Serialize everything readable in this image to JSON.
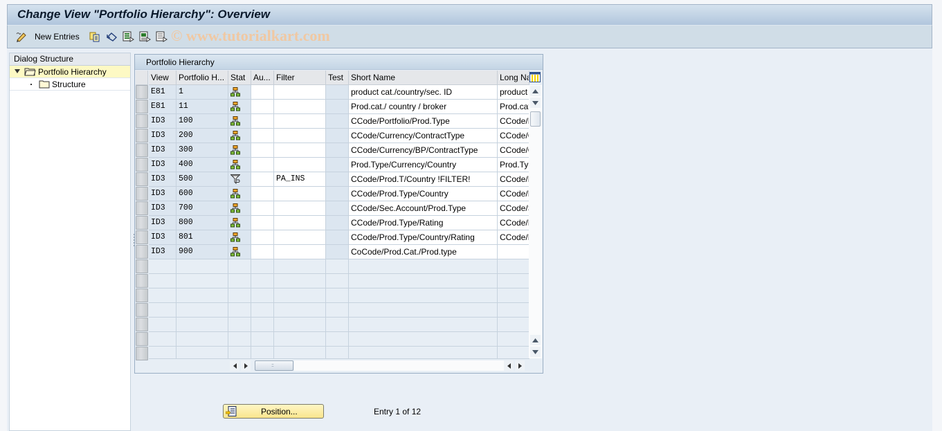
{
  "window": {
    "title": "Change View \"Portfolio Hierarchy\": Overview"
  },
  "toolbar": {
    "items": [
      {
        "icon": "edit-pencil-icon",
        "label": ""
      },
      {
        "icon": "new-entries-label",
        "label": "New Entries"
      },
      {
        "icon": "copy-as-icon",
        "label": ""
      },
      {
        "icon": "undo-change-icon",
        "label": ""
      },
      {
        "icon": "select-all-icon",
        "label": ""
      },
      {
        "icon": "select-block-icon",
        "label": ""
      },
      {
        "icon": "deselect-all-icon",
        "label": ""
      }
    ],
    "new_entries_label": "New Entries",
    "watermark": "© www.tutorialkart.com"
  },
  "dialog_structure": {
    "header": "Dialog Structure",
    "items": [
      {
        "label": "Portfolio Hierarchy",
        "expanded": true,
        "selected": true,
        "icon": "folder-open-icon"
      },
      {
        "label": "Structure",
        "expanded": false,
        "selected": false,
        "icon": "folder-icon"
      }
    ]
  },
  "table": {
    "title": "Portfolio Hierarchy",
    "columns": [
      "View",
      "Portfolio H...",
      "Stat",
      "Au...",
      "Filter",
      "Test",
      "Short Name",
      "Long Na"
    ],
    "rows": [
      {
        "view": "E81",
        "portfolio": "1",
        "stat": "hierarchy-icon",
        "au": "",
        "filter": "",
        "test": "",
        "short_name": "product cat./country/sec. ID",
        "long_name": "product"
      },
      {
        "view": "E81",
        "portfolio": "11",
        "stat": "hierarchy-icon",
        "au": "",
        "filter": "",
        "test": "",
        "short_name": "Prod.cat./ country / broker",
        "long_name": "Prod.cat"
      },
      {
        "view": "ID3",
        "portfolio": "100",
        "stat": "hierarchy-icon",
        "au": "",
        "filter": "",
        "test": "",
        "short_name": "CCode/Portfolio/Prod.Type",
        "long_name": "CCode/P"
      },
      {
        "view": "ID3",
        "portfolio": "200",
        "stat": "hierarchy-icon",
        "au": "",
        "filter": "",
        "test": "",
        "short_name": "CCode/Currency/ContractType",
        "long_name": "CCode/C"
      },
      {
        "view": "ID3",
        "portfolio": "300",
        "stat": "hierarchy-icon",
        "au": "",
        "filter": "",
        "test": "",
        "short_name": "CCode/Currency/BP/ContractType",
        "long_name": "CCode/C"
      },
      {
        "view": "ID3",
        "portfolio": "400",
        "stat": "hierarchy-icon",
        "au": "",
        "filter": "",
        "test": "",
        "short_name": "Prod.Type/Currency/Country",
        "long_name": "Prod.Ty"
      },
      {
        "view": "ID3",
        "portfolio": "500",
        "stat": "filter-icon",
        "au": "",
        "filter": "PA_INS",
        "test": "",
        "short_name": "CCode/Prod.T/Country !FILTER!",
        "long_name": "CCode/P"
      },
      {
        "view": "ID3",
        "portfolio": "600",
        "stat": "hierarchy-icon",
        "au": "",
        "filter": "",
        "test": "",
        "short_name": "CCode/Prod.Type/Country",
        "long_name": "CCode/P"
      },
      {
        "view": "ID3",
        "portfolio": "700",
        "stat": "hierarchy-icon",
        "au": "",
        "filter": "",
        "test": "",
        "short_name": "CCode/Sec.Account/Prod.Type",
        "long_name": "CCode/S"
      },
      {
        "view": "ID3",
        "portfolio": "800",
        "stat": "hierarchy-icon",
        "au": "",
        "filter": "",
        "test": "",
        "short_name": "CCode/Prod.Type/Rating",
        "long_name": "CCode/P"
      },
      {
        "view": "ID3",
        "portfolio": "801",
        "stat": "hierarchy-icon",
        "au": "",
        "filter": "",
        "test": "",
        "short_name": "CCode/Prod.Type/Country/Rating",
        "long_name": "CCode/P"
      },
      {
        "view": "ID3",
        "portfolio": "900",
        "stat": "hierarchy-icon",
        "au": "",
        "filter": "",
        "test": "",
        "short_name": "CoCode/Prod.Cat./Prod.type",
        "long_name": ""
      }
    ],
    "empty_rows": 7
  },
  "footer": {
    "position_button": "Position...",
    "entry_info": "Entry 1 of 12"
  }
}
